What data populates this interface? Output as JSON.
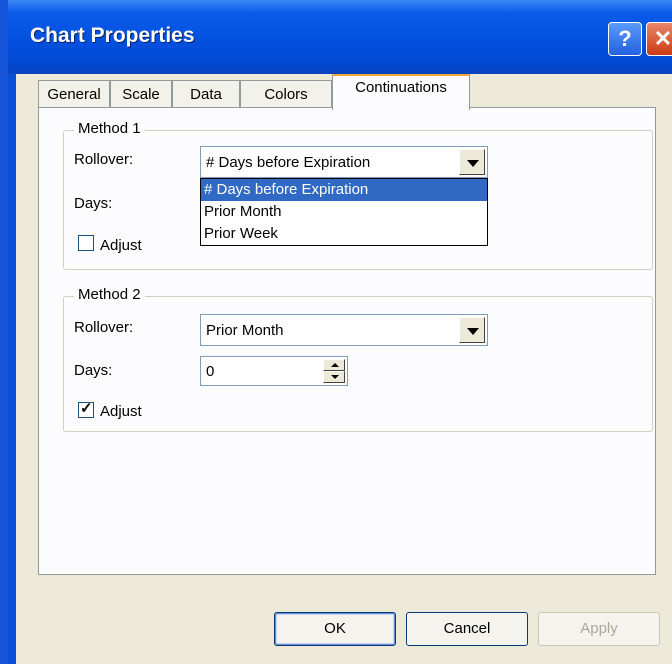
{
  "window": {
    "title": "Chart Properties",
    "help_label": "?",
    "close_label": "✕"
  },
  "tabs": [
    "General",
    "Scale",
    "Data",
    "Colors",
    "Continuations"
  ],
  "active_tab": "Continuations",
  "method1": {
    "legend": "Method 1",
    "rollover_label": "Rollover:",
    "rollover_value": "# Days before Expiration",
    "days_label": "Days:",
    "adjust_label": "Adjust",
    "adjust_checked": false,
    "dropdown_open": true,
    "dropdown_options": [
      "# Days before Expiration",
      "Prior Month",
      "Prior Week"
    ],
    "dropdown_selected": "# Days before Expiration"
  },
  "method2": {
    "legend": "Method 2",
    "rollover_label": "Rollover:",
    "rollover_value": "Prior Month",
    "days_label": "Days:",
    "days_value": "0",
    "adjust_label": "Adjust",
    "adjust_checked": true
  },
  "buttons": {
    "ok": "OK",
    "cancel": "Cancel",
    "apply": "Apply"
  },
  "colors": {
    "titlebar": "#0350df",
    "dialog_bg": "#ece9d8",
    "selection": "#316ac5",
    "active_tab_accent": "#f1a535"
  }
}
